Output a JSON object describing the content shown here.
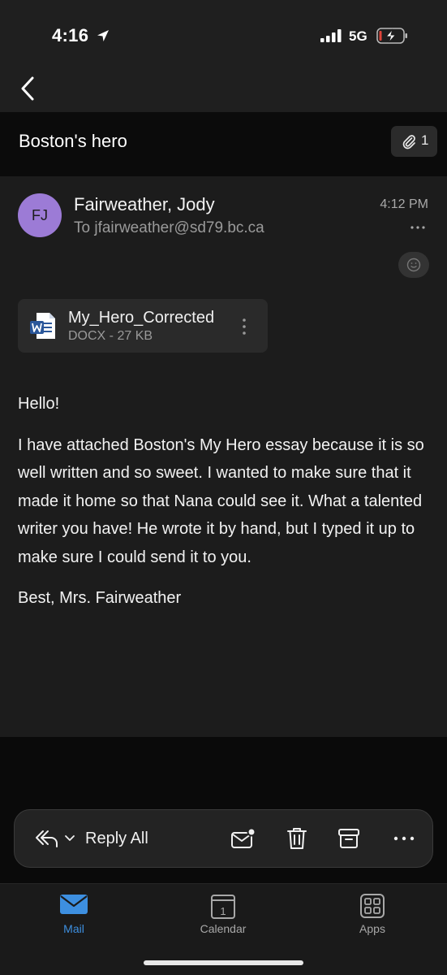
{
  "status_bar": {
    "time": "4:16",
    "network": "5G"
  },
  "subject": {
    "title": "Boston's hero",
    "attachment_count": "1"
  },
  "message": {
    "avatar_initials": "FJ",
    "sender": "Fairweather, Jody",
    "recipient": "To jfairweather@sd79.bc.ca",
    "time": "4:12 PM"
  },
  "attachment": {
    "name": "My_Hero_Corrected",
    "meta": "DOCX - 27 KB"
  },
  "body": {
    "greeting": "Hello!",
    "paragraph": "I have attached Boston's My Hero essay because it is so well written and so sweet. I wanted to make sure that it made it home so that Nana could see it. What a talented writer you have! He wrote it by hand, but I typed it up to make sure I could send it to you.",
    "signoff": "Best, Mrs. Fairweather"
  },
  "action_bar": {
    "reply_label": "Reply All"
  },
  "tabs": [
    {
      "label": "Mail",
      "active": true
    },
    {
      "label": "Calendar",
      "active": false
    },
    {
      "label": "Apps",
      "active": false
    }
  ],
  "calendar_icon_day": "1",
  "colors": {
    "accent": "#3d8fe0",
    "avatar": "#9c7bd6",
    "word_blue": "#2b579a",
    "battery_red": "#e0443a"
  }
}
